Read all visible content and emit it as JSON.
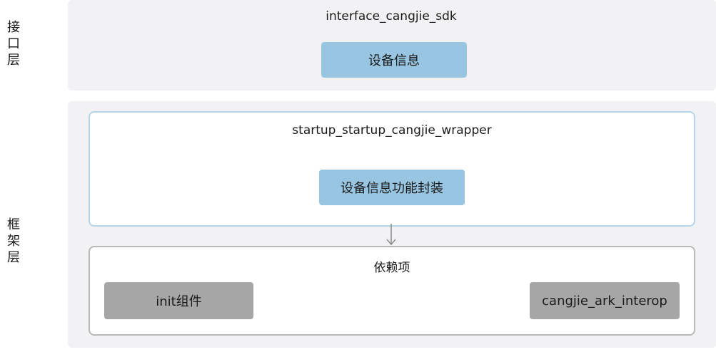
{
  "interface_layer": {
    "label_chars": [
      "接",
      "口",
      "层"
    ],
    "module_name": "interface_cangjie_sdk",
    "component": "设备信息"
  },
  "framework_layer": {
    "label_chars": [
      "框",
      "架",
      "层"
    ],
    "wrapper": {
      "module_name": "startup_startup_cangjie_wrapper",
      "component": "设备信息功能封装"
    },
    "dependencies": {
      "title": "依赖项",
      "items": [
        "init组件",
        "cangjie_ark_interop"
      ]
    }
  },
  "colors": {
    "panel_bg": "#f2f2f4",
    "component_blue": "#98c6e2",
    "wrapper_border": "#b3d5ea",
    "dependency_gray": "#a6a6a6",
    "dependency_border": "#b8b8b8",
    "arrow": "#888888"
  }
}
